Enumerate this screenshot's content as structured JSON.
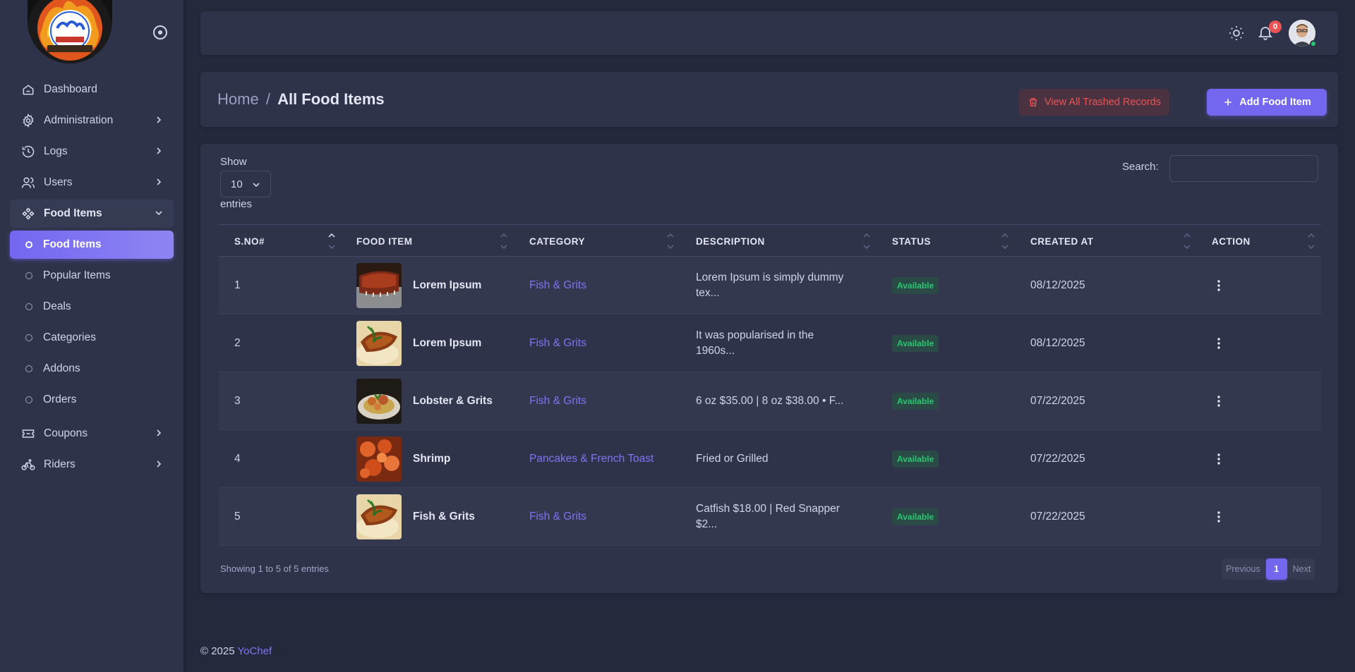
{
  "sidebar": {
    "items": [
      {
        "label": "Dashboard",
        "icon": "home-icon"
      },
      {
        "label": "Administration",
        "icon": "gear-icon"
      },
      {
        "label": "Logs",
        "icon": "history-icon"
      },
      {
        "label": "Users",
        "icon": "users-icon"
      },
      {
        "label": "Food Items",
        "icon": "food-icon",
        "open": true
      },
      {
        "label": "Coupons",
        "icon": "ticket-icon"
      },
      {
        "label": "Riders",
        "icon": "bike-icon"
      }
    ],
    "food_sub_items": [
      {
        "label": "Food Items",
        "active": true
      },
      {
        "label": "Popular Items"
      },
      {
        "label": "Deals"
      },
      {
        "label": "Categories"
      },
      {
        "label": "Addons"
      },
      {
        "label": "Orders"
      }
    ]
  },
  "topbar": {
    "notification_count": "0"
  },
  "header": {
    "breadcrumb_home": "Home",
    "breadcrumb_sep": "/",
    "breadcrumb_current": "All Food Items",
    "trash_button": "View All Trashed Records",
    "add_button": "Add Food Item"
  },
  "table": {
    "show_label": "Show",
    "page_length": "10",
    "entries_label": "entries",
    "search_label": "Search:",
    "search_value": "",
    "columns": [
      "S.NO#",
      "FOOD ITEM",
      "CATEGORY",
      "DESCRIPTION",
      "STATUS",
      "CREATED AT",
      "ACTION"
    ],
    "rows": [
      {
        "sno": "1",
        "name": "Lorem Ipsum",
        "category": "Fish & Grits",
        "description": "Lorem Ipsum is simply dummy tex...",
        "status": "Available",
        "created_at": "08/12/2025",
        "thumb": "ribs"
      },
      {
        "sno": "2",
        "name": "Lorem Ipsum",
        "category": "Fish & Grits",
        "description": "It was popularised in the 1960s...",
        "status": "Available",
        "created_at": "08/12/2025",
        "thumb": "fish"
      },
      {
        "sno": "3",
        "name": "Lobster & Grits",
        "category": "Fish & Grits",
        "description": "6 oz $35.00 | 8 oz $38.00 • F...",
        "status": "Available",
        "created_at": "07/22/2025",
        "thumb": "lobster"
      },
      {
        "sno": "4",
        "name": "Shrimp",
        "category": "Pancakes & French Toast",
        "description": "Fried or Grilled",
        "status": "Available",
        "created_at": "07/22/2025",
        "thumb": "shrimp"
      },
      {
        "sno": "5",
        "name": "Fish & Grits",
        "category": "Fish & Grits",
        "description": "Catfish $18.00 | Red Snapper $2...",
        "status": "Available",
        "created_at": "07/22/2025",
        "thumb": "fish"
      }
    ],
    "info": "Showing 1 to 5 of 5 entries",
    "pager": {
      "previous": "Previous",
      "current": "1",
      "next": "Next"
    }
  },
  "footer": {
    "copyright": "© 2025",
    "brand": "YoChef"
  },
  "colors": {
    "accent": "#7367f0",
    "danger": "#ea5455",
    "success": "#28c76f",
    "background": "#25293c",
    "card": "#2f3349"
  }
}
